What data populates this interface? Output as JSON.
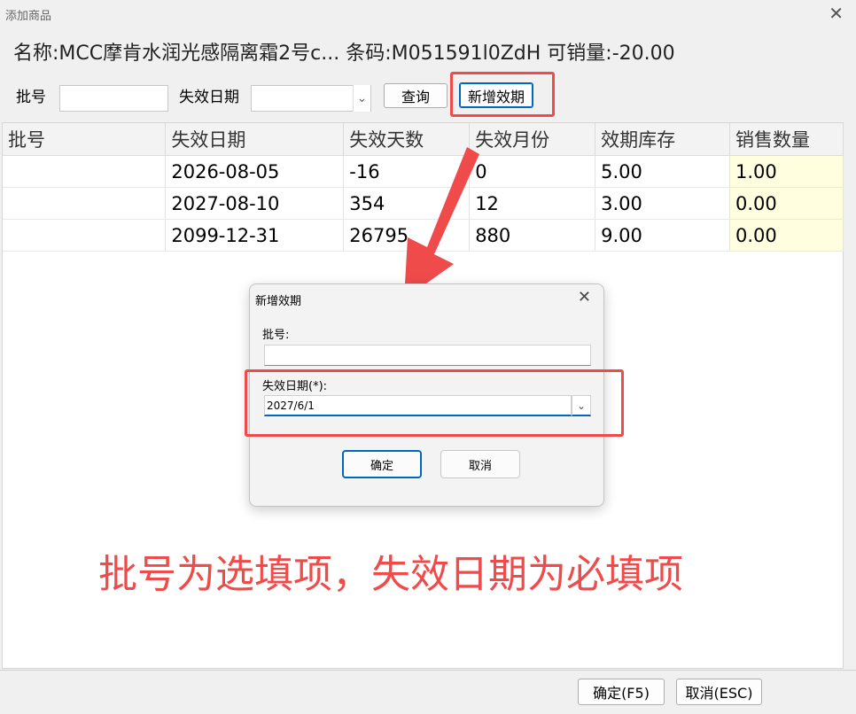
{
  "window": {
    "title": "添加商品"
  },
  "info": {
    "name_label": "名称:",
    "name_value": "MCC摩肯水润光感隔离霜2号c...",
    "barcode_label": "条码:",
    "barcode_value": "M051591l0ZdH",
    "sellable_label": "可销量:",
    "sellable_value": "-20.00"
  },
  "filter": {
    "batch_label": "批号",
    "batch_value": "",
    "expiry_label": "失效日期",
    "expiry_value": "",
    "query_button": "查询",
    "add_expiry_button": "新增效期"
  },
  "table": {
    "columns": [
      "批号",
      "失效日期",
      "失效天数",
      "失效月份",
      "效期库存",
      "销售数量"
    ],
    "rows": [
      {
        "batch": "",
        "expiry_date": "2026-08-05",
        "days": "-16",
        "months": "0",
        "stock": "5.00",
        "qty": "1.00"
      },
      {
        "batch": "",
        "expiry_date": "2027-08-10",
        "days": "354",
        "months": "12",
        "stock": "3.00",
        "qty": "0.00"
      },
      {
        "batch": "",
        "expiry_date": "2099-12-31",
        "days": "26795",
        "months": "880",
        "stock": "9.00",
        "qty": "0.00"
      }
    ]
  },
  "dialog": {
    "title": "新增效期",
    "batch_label": "批号:",
    "batch_value": "",
    "expiry_label": "失效日期(*):",
    "expiry_value": "2027/6/1",
    "ok_button": "确定",
    "cancel_button": "取消"
  },
  "annotation": {
    "text": "批号为选填项，失效日期为必填项",
    "color": "#ef4b4b"
  },
  "footer": {
    "ok_button": "确定(F5)",
    "cancel_button": "取消(ESC)"
  },
  "colors": {
    "highlight_red": "#ef4b4b",
    "sale_cell_bg": "#ffffe0",
    "accent_blue": "#0067c0"
  },
  "icons": {
    "close": "close-icon",
    "dropdown": "chevron-down-icon"
  }
}
